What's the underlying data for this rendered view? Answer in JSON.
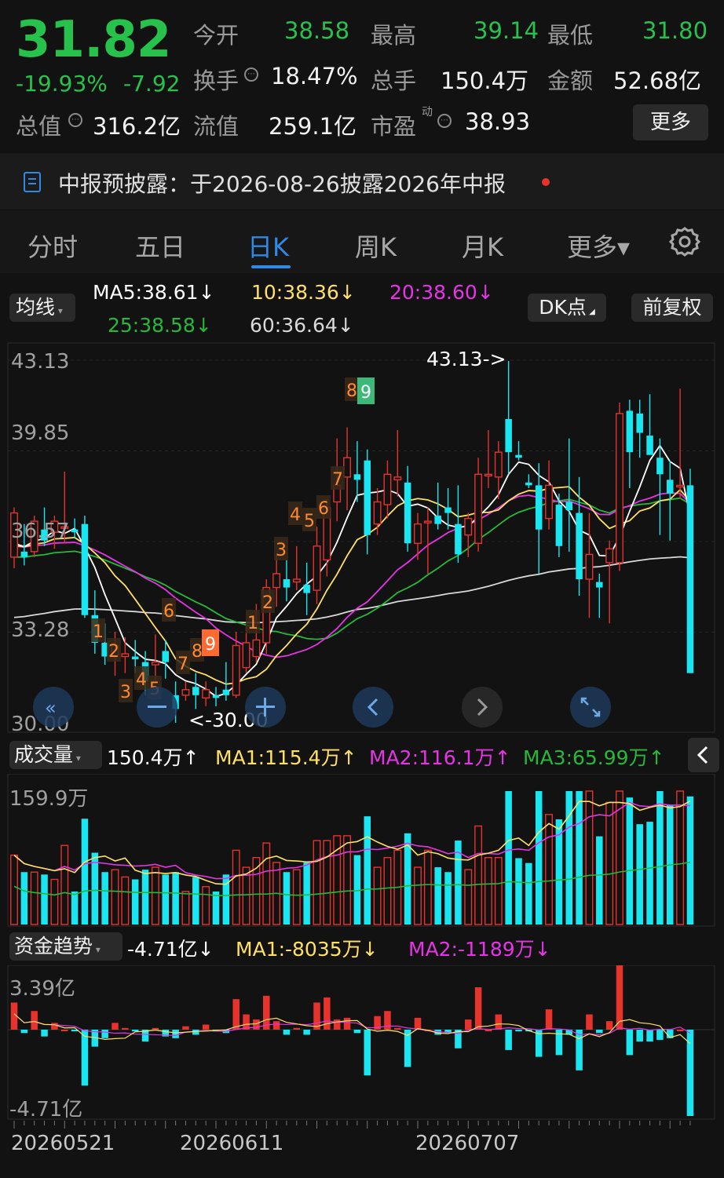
{
  "quote": {
    "price": "31.82",
    "change_pct": "-19.93%",
    "change_amt": "-7.92",
    "open_label": "今开",
    "open": "38.58",
    "high_label": "最高",
    "high": "39.14",
    "low_label": "最低",
    "low": "31.80",
    "turnover_label": "换手",
    "turnover": "18.47%",
    "volume_label": "总手",
    "volume": "150.4万",
    "amount_label": "金额",
    "amount": "52.68亿",
    "mktcap_label": "总值",
    "mktcap": "316.2亿",
    "float_label": "流值",
    "float": "259.1亿",
    "pe_label": "市盈",
    "pe_sup": "动",
    "pe": "38.93",
    "more_button": "更多"
  },
  "notice": {
    "text": "中报预披露：于2026-08-26披露2026年中报"
  },
  "tabs": [
    {
      "label": "分时"
    },
    {
      "label": "五日"
    },
    {
      "label": "日K"
    },
    {
      "label": "周K"
    },
    {
      "label": "月K"
    },
    {
      "label": "更多▾"
    }
  ],
  "colors": {
    "up": "#e8322c",
    "down": "#19e6f0",
    "green": "#27c24c",
    "ma5": "#ffffff",
    "ma10": "#ffe066",
    "ma20": "#e533e5",
    "ma25": "#27b83a",
    "ma60": "#d9d9d9"
  },
  "ma": {
    "selector": "均线",
    "ma5": "MA5:38.61↓",
    "ma10": "10:38.36↓",
    "ma20": "20:38.60↓",
    "ma25": "25:38.58↓",
    "ma60": "60:36.64↓",
    "dk_button": "DK点",
    "adjust_button": "前复权"
  },
  "price_chart": {
    "y_labels": [
      "43.13",
      "39.85",
      "36.57",
      "33.28",
      "30.00"
    ],
    "max_label": "43.13->",
    "min_label": "<-30.00"
  },
  "volume": {
    "selector": "成交量",
    "value": "150.4万↑",
    "ma1": "MA1:115.4万↑",
    "ma2": "MA2:116.1万↑",
    "ma3": "MA3:65.99万↑",
    "y_label": "159.9万"
  },
  "fund": {
    "selector": "资金趋势",
    "value": "-4.71亿↓",
    "ma1": "MA1:-8035万↓",
    "ma2": "MA2:-1189万↓",
    "y_top": "3.39亿",
    "y_bottom": "-4.71亿"
  },
  "dates": [
    "20260521",
    "20260611",
    "20260707"
  ],
  "chart_data": {
    "type": "candlestick",
    "candles": [
      [
        36.0,
        37.8,
        35.6,
        37.6
      ],
      [
        36.2,
        37.2,
        35.7,
        36.0
      ],
      [
        36.2,
        37.5,
        36.0,
        37.3
      ],
      [
        37.0,
        37.8,
        36.4,
        36.6
      ],
      [
        36.9,
        37.5,
        36.3,
        37.3
      ],
      [
        37.1,
        39.1,
        36.5,
        37.1
      ],
      [
        37.0,
        37.4,
        36.7,
        36.9
      ],
      [
        37.2,
        37.5,
        33.8,
        33.9
      ],
      [
        33.9,
        34.8,
        32.5,
        32.9
      ],
      [
        32.9,
        33.6,
        32.1,
        32.4
      ],
      [
        32.4,
        33.3,
        31.7,
        32.8
      ],
      [
        32.4,
        33.1,
        31.8,
        32.5
      ],
      [
        32.4,
        33.0,
        31.8,
        32.3
      ],
      [
        32.2,
        32.6,
        31.0,
        31.5
      ],
      [
        32.1,
        33.2,
        31.5,
        32.2
      ],
      [
        32.6,
        33.0,
        31.6,
        32.2
      ],
      [
        31.0,
        31.5,
        30.0,
        30.5
      ],
      [
        31.0,
        31.5,
        30.8,
        31.2
      ],
      [
        31.3,
        31.8,
        30.5,
        31.0
      ],
      [
        30.9,
        31.5,
        30.6,
        31.2
      ],
      [
        31.0,
        31.3,
        30.6,
        30.9
      ],
      [
        31.2,
        32.2,
        30.8,
        31.0
      ],
      [
        31.0,
        33.3,
        30.9,
        32.8
      ],
      [
        32.0,
        33.5,
        31.8,
        32.9
      ],
      [
        32.4,
        34.3,
        32.2,
        33.0
      ],
      [
        32.9,
        35.2,
        32.5,
        34.9
      ],
      [
        34.9,
        36.1,
        34.2,
        35.4
      ],
      [
        35.2,
        35.9,
        34.4,
        34.9
      ],
      [
        35.1,
        36.4,
        34.8,
        35.2
      ],
      [
        35.0,
        35.8,
        33.9,
        34.7
      ],
      [
        34.8,
        37.1,
        34.3,
        36.4
      ],
      [
        35.9,
        38.1,
        35.3,
        37.8
      ],
      [
        38.0,
        40.3,
        37.3,
        38.6
      ],
      [
        38.9,
        40.7,
        37.7,
        39.6
      ],
      [
        39.0,
        40.2,
        38.0,
        38.8
      ],
      [
        39.5,
        39.9,
        36.1,
        36.8
      ],
      [
        37.2,
        38.5,
        36.8,
        38.0
      ],
      [
        37.9,
        39.5,
        37.4,
        39.0
      ],
      [
        38.8,
        40.6,
        38.2,
        38.9
      ],
      [
        38.7,
        39.3,
        36.2,
        36.5
      ],
      [
        36.5,
        37.6,
        35.9,
        37.2
      ],
      [
        37.3,
        37.8,
        35.4,
        37.3
      ],
      [
        37.5,
        38.7,
        37.0,
        37.2
      ],
      [
        37.8,
        38.5,
        37.0,
        37.6
      ],
      [
        37.2,
        38.6,
        35.8,
        36.1
      ],
      [
        36.8,
        37.6,
        36.0,
        37.4
      ],
      [
        36.5,
        39.6,
        36.2,
        39.0
      ],
      [
        39.0,
        40.6,
        38.5,
        39.0
      ],
      [
        38.9,
        40.2,
        38.1,
        39.8
      ],
      [
        41.0,
        43.1,
        39.0,
        39.8
      ],
      [
        39.7,
        40.2,
        39.5,
        39.6
      ],
      [
        38.7,
        39.0,
        38.5,
        38.6
      ],
      [
        38.6,
        39.4,
        35.4,
        37.0
      ],
      [
        37.4,
        39.5,
        37.0,
        38.6
      ],
      [
        37.9,
        38.3,
        36.0,
        36.4
      ],
      [
        38.0,
        40.3,
        36.2,
        37.7
      ],
      [
        37.6,
        38.9,
        34.6,
        35.2
      ],
      [
        35.2,
        37.6,
        33.8,
        36.1
      ],
      [
        35.1,
        35.4,
        33.8,
        34.9
      ],
      [
        35.8,
        36.6,
        33.6,
        36.3
      ],
      [
        35.8,
        41.6,
        35.5,
        41.2
      ],
      [
        41.3,
        41.7,
        38.5,
        39.8
      ],
      [
        41.2,
        41.7,
        39.6,
        40.5
      ],
      [
        40.4,
        41.9,
        39.7,
        39.7
      ],
      [
        39.6,
        40.3,
        36.8,
        39.0
      ],
      [
        38.8,
        39.5,
        36.6,
        38.3
      ],
      [
        38.6,
        42.1,
        38.1,
        38.6
      ],
      [
        38.6,
        39.2,
        31.8,
        31.8
      ]
    ]
  }
}
